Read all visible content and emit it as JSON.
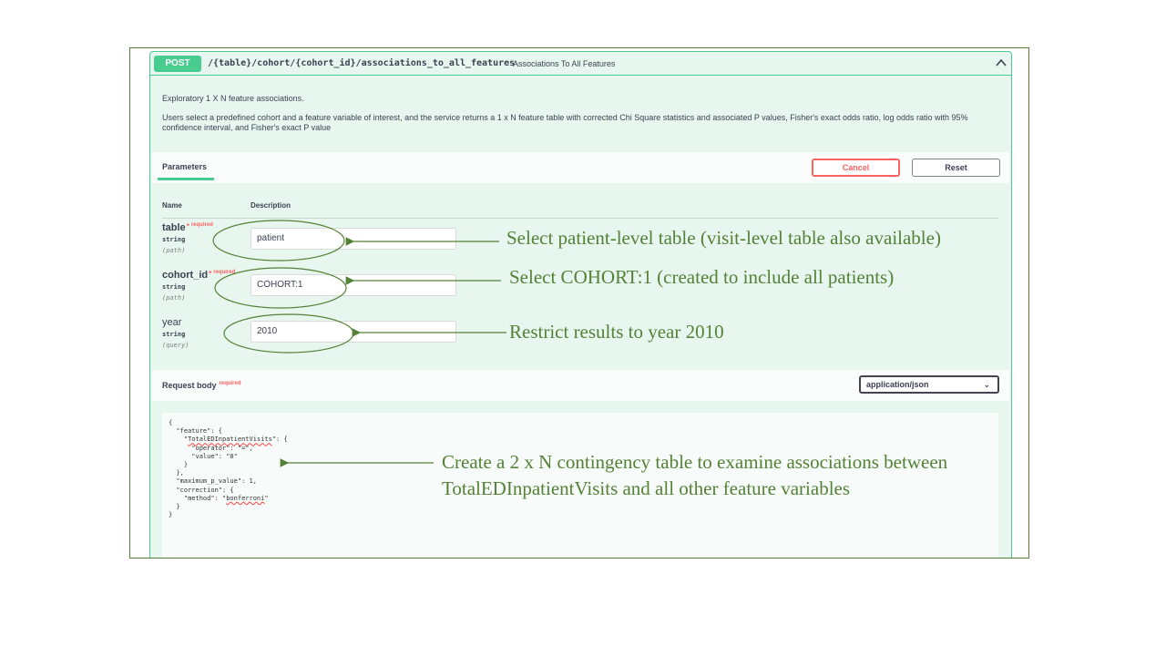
{
  "endpoint": {
    "method": "POST",
    "path": "/{table}/cohort/{cohort_id}/associations_to_all_features",
    "summary": "Associations To All Features"
  },
  "description": {
    "line1": "Exploratory 1 X N feature associations.",
    "line2": "Users select a predefined cohort and a feature variable of interest, and the service returns a 1 x N feature table with corrected Chi Square statistics and associated P values, Fisher's exact odds ratio, log odds ratio with 95% confidence interval, and Fisher's exact P value"
  },
  "parameters": {
    "tab_label": "Parameters",
    "cancel_label": "Cancel",
    "reset_label": "Reset",
    "col_name": "Name",
    "col_description": "Description",
    "required_label": "required",
    "required_star": "*",
    "items": [
      {
        "name": "table",
        "type": "string",
        "in": "(path)",
        "value": "patient"
      },
      {
        "name": "cohort_id",
        "type": "string",
        "in": "(path)",
        "value": "COHORT:1"
      },
      {
        "name": "year",
        "type": "string",
        "in": "(query)",
        "value": "2010"
      }
    ]
  },
  "request_body": {
    "label": "Request body",
    "required_label": "required",
    "content_type": "application/json",
    "code": {
      "l1": "{",
      "l2": "  \"feature\": {",
      "l3_pre": "    \"",
      "l3_key": "TotalEDInpatientVisits",
      "l3_post": "\": {",
      "l4": "      \"operator\": \"=\",",
      "l5": "      \"value\": \"0\"",
      "l6": "    }",
      "l7": "  },",
      "l8": "  \"maximum_p_value\": 1,",
      "l9": "  \"correction\": {",
      "l10_pre": "    \"method\": \"",
      "l10_val": "bonferroni",
      "l10_post": "\"",
      "l11": "  }",
      "l12": "}"
    }
  },
  "annotations": {
    "table": "Select patient-level table (visit-level table also available)",
    "cohort": "Select COHORT:1 (created to include all patients)",
    "year": "Restrict results to year 2010",
    "body": "Create a 2 x N contingency table to examine associations between TotalEDInpatientVisits and all other feature variables"
  },
  "colors": {
    "post_green": "#49cc90",
    "annotation_green": "#538135",
    "required_red": "#ff6060"
  }
}
